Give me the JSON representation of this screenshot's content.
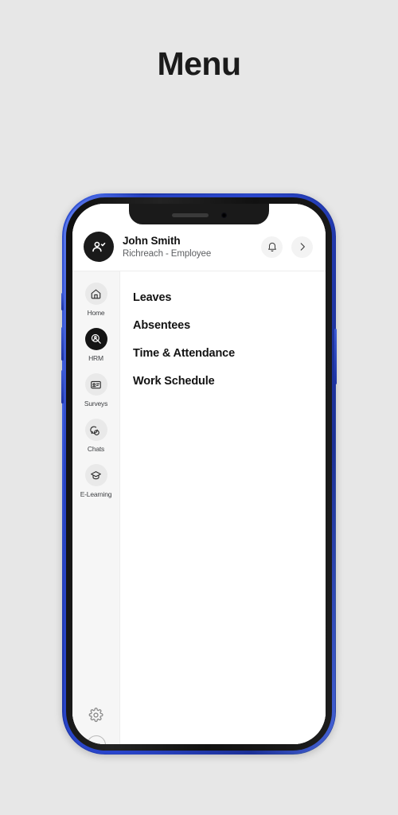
{
  "page": {
    "title": "Menu",
    "background_color": "#e7e7e7"
  },
  "device": {
    "frame_color": "#2a46c4",
    "bezel_color": "#151515",
    "notch": {
      "speaker_name": "earpiece-speaker",
      "camera_name": "front-camera"
    },
    "buttons": [
      {
        "name": "silent-switch"
      },
      {
        "name": "volume-up-button"
      },
      {
        "name": "volume-down-button"
      },
      {
        "name": "power-button"
      }
    ]
  },
  "header": {
    "avatar_icon": "user-add-icon",
    "user_name": "John Smith",
    "user_role": "Richreach - Employee",
    "notification_icon": "bell-icon",
    "expand_icon": "chevron-right-icon"
  },
  "sidebar": {
    "background_color": "#f6f6f6",
    "active_color": "#141414",
    "items": [
      {
        "label": "Home",
        "icon": "home-icon",
        "active": false
      },
      {
        "label": "HRM",
        "icon": "hrm-search-icon",
        "active": true
      },
      {
        "label": "Surveys",
        "icon": "survey-card-icon",
        "active": false
      },
      {
        "label": "Chats",
        "icon": "chat-bubble-icon",
        "active": false
      },
      {
        "label": "E-Learning",
        "icon": "graduation-cap-icon",
        "active": false
      }
    ],
    "settings_icon": "gear-icon",
    "partial_icon": "help-circle-icon"
  },
  "menu": {
    "items": [
      {
        "label": "Leaves"
      },
      {
        "label": "Absentees"
      },
      {
        "label": "Time & Attendance"
      },
      {
        "label": "Work Schedule"
      }
    ]
  }
}
